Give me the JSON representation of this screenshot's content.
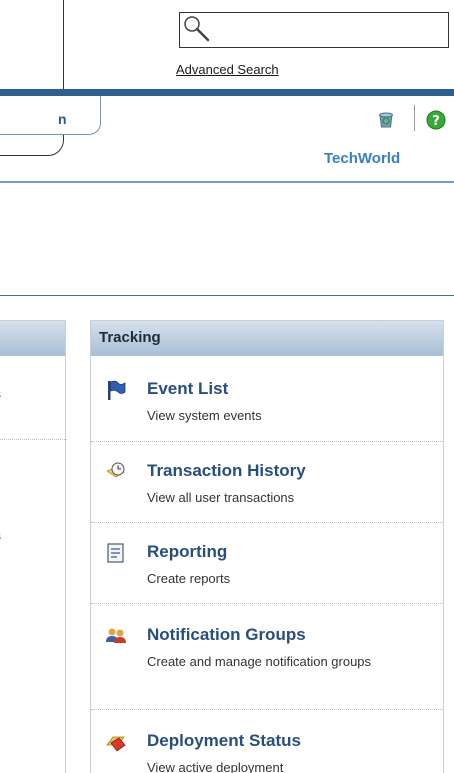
{
  "header": {
    "search": {
      "value": "",
      "placeholder": ""
    },
    "advanced_search_label": "Advanced Search",
    "tab_fragment": "n",
    "site_name": "TechWorld"
  },
  "left_panel": {
    "fragments": [
      "s",
      "s"
    ]
  },
  "tracking": {
    "title": "Tracking",
    "items": [
      {
        "title": "Event List",
        "desc": "View system events",
        "icon": "flag-icon"
      },
      {
        "title": "Transaction History",
        "desc": "View all user transactions",
        "icon": "clock-icon"
      },
      {
        "title": "Reporting",
        "desc": "Create reports",
        "icon": "report-icon"
      },
      {
        "title": "Notification Groups",
        "desc": "Create and manage notification groups",
        "icon": "users-icon"
      },
      {
        "title": "Deployment Status",
        "desc": "View active deployment",
        "icon": "deployment-icon"
      }
    ]
  },
  "colors": {
    "header_rule": "#2f5f8c",
    "link_blue": "#274e7f",
    "site_name": "#3a7fc0",
    "panel_header": "#a8bfd6"
  }
}
